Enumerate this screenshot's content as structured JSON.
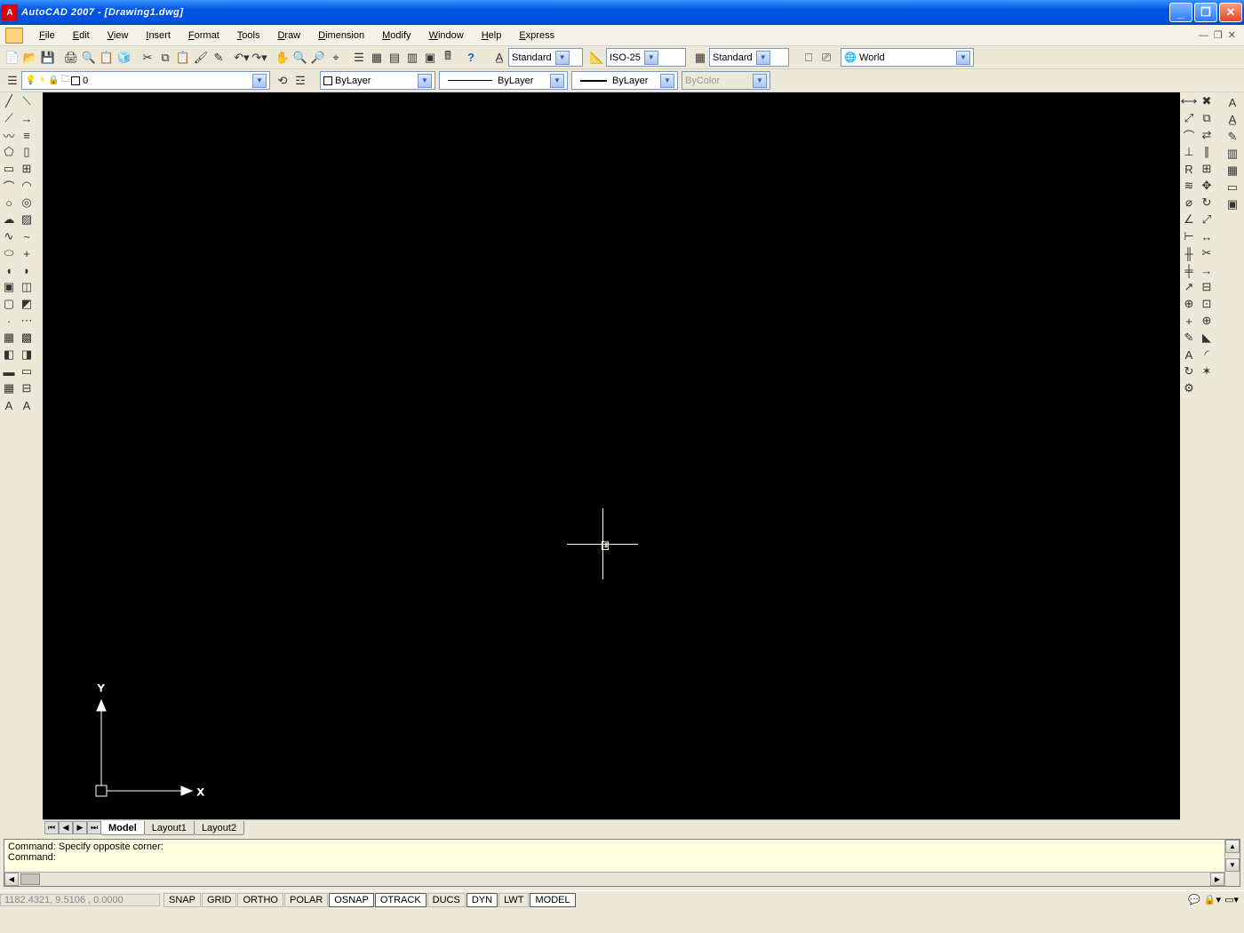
{
  "title": "AutoCAD 2007 - [Drawing1.dwg]",
  "menus": [
    "File",
    "Edit",
    "View",
    "Insert",
    "Format",
    "Tools",
    "Draw",
    "Dimension",
    "Modify",
    "Window",
    "Help",
    "Express"
  ],
  "styles_row": {
    "text_style_label": "Standard",
    "dim_style_label": "ISO-25",
    "table_style_label": "Standard",
    "world_label": "World"
  },
  "properties_row": {
    "layer_list_label": "0",
    "color_label": "ByLayer",
    "linetype_label": "ByLayer",
    "lineweight_label": "ByLayer",
    "plotstyle_label": "ByColor"
  },
  "canvas": {
    "ucs": {
      "x_label": "X",
      "y_label": "Y"
    }
  },
  "sheet_tabs": {
    "tabs": [
      "Model",
      "Layout1",
      "Layout2"
    ],
    "active": 0
  },
  "command_window": {
    "line1": "Command: Specify opposite corner:",
    "line2": "Command:"
  },
  "statusbar": {
    "coords": "1182.4321, 9.5106 , 0.0000",
    "buttons": [
      "SNAP",
      "GRID",
      "ORTHO",
      "POLAR",
      "OSNAP",
      "OTRACK",
      "DUCS",
      "DYN",
      "LWT",
      "MODEL"
    ],
    "active_buttons": [
      "OSNAP",
      "OTRACK",
      "DYN",
      "MODEL"
    ]
  },
  "left_tools_col1": [
    "line",
    "cline",
    "pline",
    "polygon",
    "rect",
    "arc",
    "circle",
    "revcloud",
    "spline",
    "ellipse",
    "earc",
    "iblock",
    "mblock",
    "point",
    "hatch",
    "grad",
    "region",
    "table",
    "mtext"
  ],
  "left_tools_col2": [
    "xline",
    "ray",
    "mline",
    "rectangle",
    "array",
    "arc2",
    "donut",
    "wipeout",
    "spline2",
    "axis",
    "earc2",
    "block",
    "wblock",
    "divide",
    "bhatch",
    "grad2",
    "boundary",
    "tbl",
    "text"
  ],
  "right_tools_colA": [
    "dimlinear",
    "dimaligned",
    "dimarc",
    "dimord",
    "dimradius",
    "dimjog",
    "dimdia",
    "dimang",
    "qdim",
    "dimbase",
    "dimcont",
    "qleader",
    "tol",
    "center",
    "dimedit",
    "dimtedit",
    "dimupd",
    "dimstyle"
  ],
  "right_tools_colB": [
    "erase",
    "copy",
    "mirror",
    "offset",
    "array",
    "move",
    "rotate",
    "scale",
    "stretch",
    "trim",
    "extend",
    "break",
    "breakat",
    "join",
    "chamfer",
    "fillet",
    "explode"
  ],
  "right_tools_single": [
    "text-a",
    "text-ai",
    "text-sym",
    "fields",
    "htable",
    "book",
    "book2"
  ],
  "icon_glyphs": {
    "new": "📄",
    "open": "📂",
    "save": "💾",
    "plot": "🖨",
    "preview": "🔍",
    "publish": "📋",
    "cut": "✂",
    "copy": "⧉",
    "paste": "📋",
    "match": "🖌",
    "undo": "↶",
    "redo": "↷",
    "pan": "✋",
    "zoomrt": "🔍",
    "zoomw": "🔎",
    "zoomp": "⌖",
    "props": "☰",
    "dc": "▦",
    "tool": "▤",
    "sheet": "▥",
    "markup": "▣",
    "calc": "🖩",
    "help": "?",
    "line": "╱",
    "cline": "⟋",
    "pline": "〰",
    "polygon": "⬠",
    "rect": "▭",
    "arc": "⌒",
    "circle": "○",
    "revcloud": "☁",
    "spline": "∿",
    "ellipse": "⬭",
    "earc": "◖",
    "iblock": "▣",
    "mblock": "▢",
    "point": "·",
    "hatch": "▦",
    "grad": "◧",
    "region": "▬",
    "table": "▦",
    "mtext": "A",
    "xline": "⟍",
    "ray": "→",
    "mline": "≡",
    "rectangle": "▯",
    "array": "⊞",
    "arc2": "◠",
    "donut": "◎",
    "wipeout": "▨",
    "spline2": "~",
    "axis": "+",
    "earc2": "◗",
    "block": "◫",
    "wblock": "◩",
    "divide": "⋯",
    "bhatch": "▩",
    "grad2": "◨",
    "boundary": "▭",
    "tbl": "⊟",
    "text": "A",
    "dimlinear": "⟷",
    "dimaligned": "⤢",
    "dimarc": "⌒",
    "dimord": "⊥",
    "dimradius": "R",
    "dimjog": "≋",
    "dimdia": "⌀",
    "dimang": "∠",
    "qdim": "⊢",
    "dimbase": "╫",
    "dimcont": "╪",
    "qleader": "↗",
    "tol": "⊕",
    "center": "+",
    "dimedit": "✎",
    "dimtedit": "A",
    "dimupd": "↻",
    "dimstyle": "⚙",
    "erase": "✖",
    "mirror": "⇄",
    "offset": "∥",
    "move": "✥",
    "rotate": "↻",
    "scale": "⤢",
    "stretch": "↔",
    "trim": "✂",
    "extend": "→",
    "break": "⊟",
    "breakat": "⊡",
    "join": "⊕",
    "chamfer": "◣",
    "fillet": "◜",
    "explode": "✶",
    "text-a": "A",
    "text-ai": "A̲",
    "text-sym": "✎",
    "fields": "▥",
    "htable": "▦",
    "book": "▭",
    "book2": "▣"
  }
}
